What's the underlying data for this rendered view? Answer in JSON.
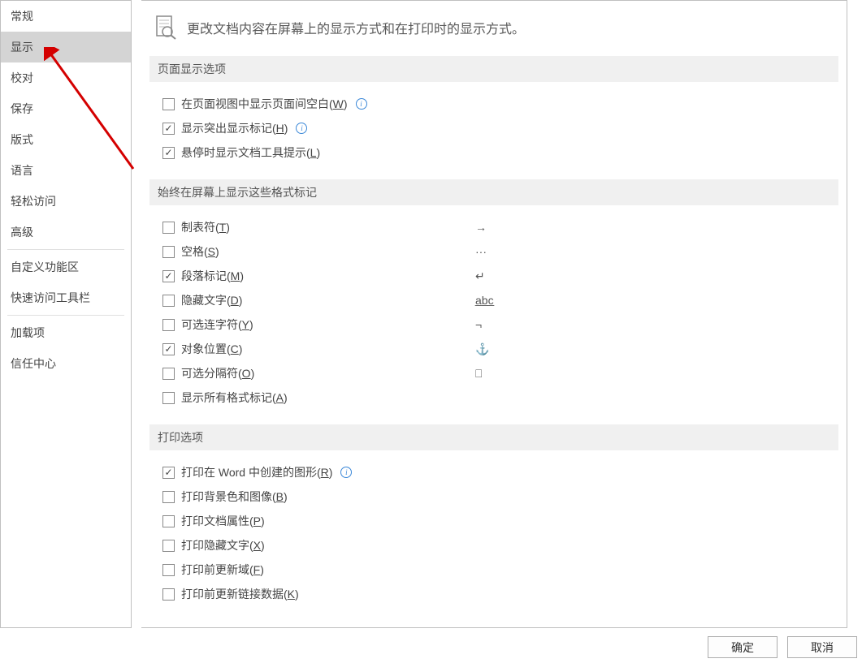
{
  "sidebar": {
    "items": [
      "常规",
      "显示",
      "校对",
      "保存",
      "版式",
      "语言",
      "轻松访问",
      "高级",
      "自定义功能区",
      "快速访问工具栏",
      "加载项",
      "信任中心"
    ],
    "selectedIndex": 1
  },
  "title": "更改文档内容在屏幕上的显示方式和在打印时的显示方式。",
  "sections": {
    "pageDisplay": {
      "header": "页面显示选项",
      "options": [
        {
          "label": "在页面视图中显示页面间空白(",
          "key": "W",
          "suffix": ")",
          "checked": false,
          "info": true
        },
        {
          "label": "显示突出显示标记(",
          "key": "H",
          "suffix": ")",
          "checked": true,
          "info": true
        },
        {
          "label": "悬停时显示文档工具提示(",
          "key": "L",
          "suffix": ")",
          "checked": true,
          "info": false
        }
      ]
    },
    "formatMarks": {
      "header": "始终在屏幕上显示这些格式标记",
      "options": [
        {
          "label": "制表符(",
          "key": "T",
          "suffix": ")",
          "checked": false,
          "symbol": "→"
        },
        {
          "label": "空格(",
          "key": "S",
          "suffix": ")",
          "checked": false,
          "symbol": "···"
        },
        {
          "label": "段落标记(",
          "key": "M",
          "suffix": ")",
          "checked": true,
          "symbol": "↵"
        },
        {
          "label": "隐藏文字(",
          "key": "D",
          "suffix": ")",
          "checked": false,
          "symbol": "a̲b̲c̲"
        },
        {
          "label": "可选连字符(",
          "key": "Y",
          "suffix": ")",
          "checked": false,
          "symbol": "¬"
        },
        {
          "label": "对象位置(",
          "key": "C",
          "suffix": ")",
          "checked": true,
          "symbol": "⚓"
        },
        {
          "label": "可选分隔符(",
          "key": "O",
          "suffix": ")",
          "checked": false,
          "symbol": "⎕"
        },
        {
          "label": "显示所有格式标记(",
          "key": "A",
          "suffix": ")",
          "checked": false,
          "symbol": ""
        }
      ]
    },
    "printing": {
      "header": "打印选项",
      "options": [
        {
          "label": "打印在 Word 中创建的图形(",
          "key": "R",
          "suffix": ")",
          "checked": true,
          "info": true
        },
        {
          "label": "打印背景色和图像(",
          "key": "B",
          "suffix": ")",
          "checked": false,
          "info": false
        },
        {
          "label": "打印文档属性(",
          "key": "P",
          "suffix": ")",
          "checked": false,
          "info": false
        },
        {
          "label": "打印隐藏文字(",
          "key": "X",
          "suffix": ")",
          "checked": false,
          "info": false
        },
        {
          "label": "打印前更新域(",
          "key": "F",
          "suffix": ")",
          "checked": false,
          "info": false
        },
        {
          "label": "打印前更新链接数据(",
          "key": "K",
          "suffix": ")",
          "checked": false,
          "info": false
        }
      ]
    }
  },
  "buttons": {
    "ok": "确定",
    "cancel": "取消"
  }
}
